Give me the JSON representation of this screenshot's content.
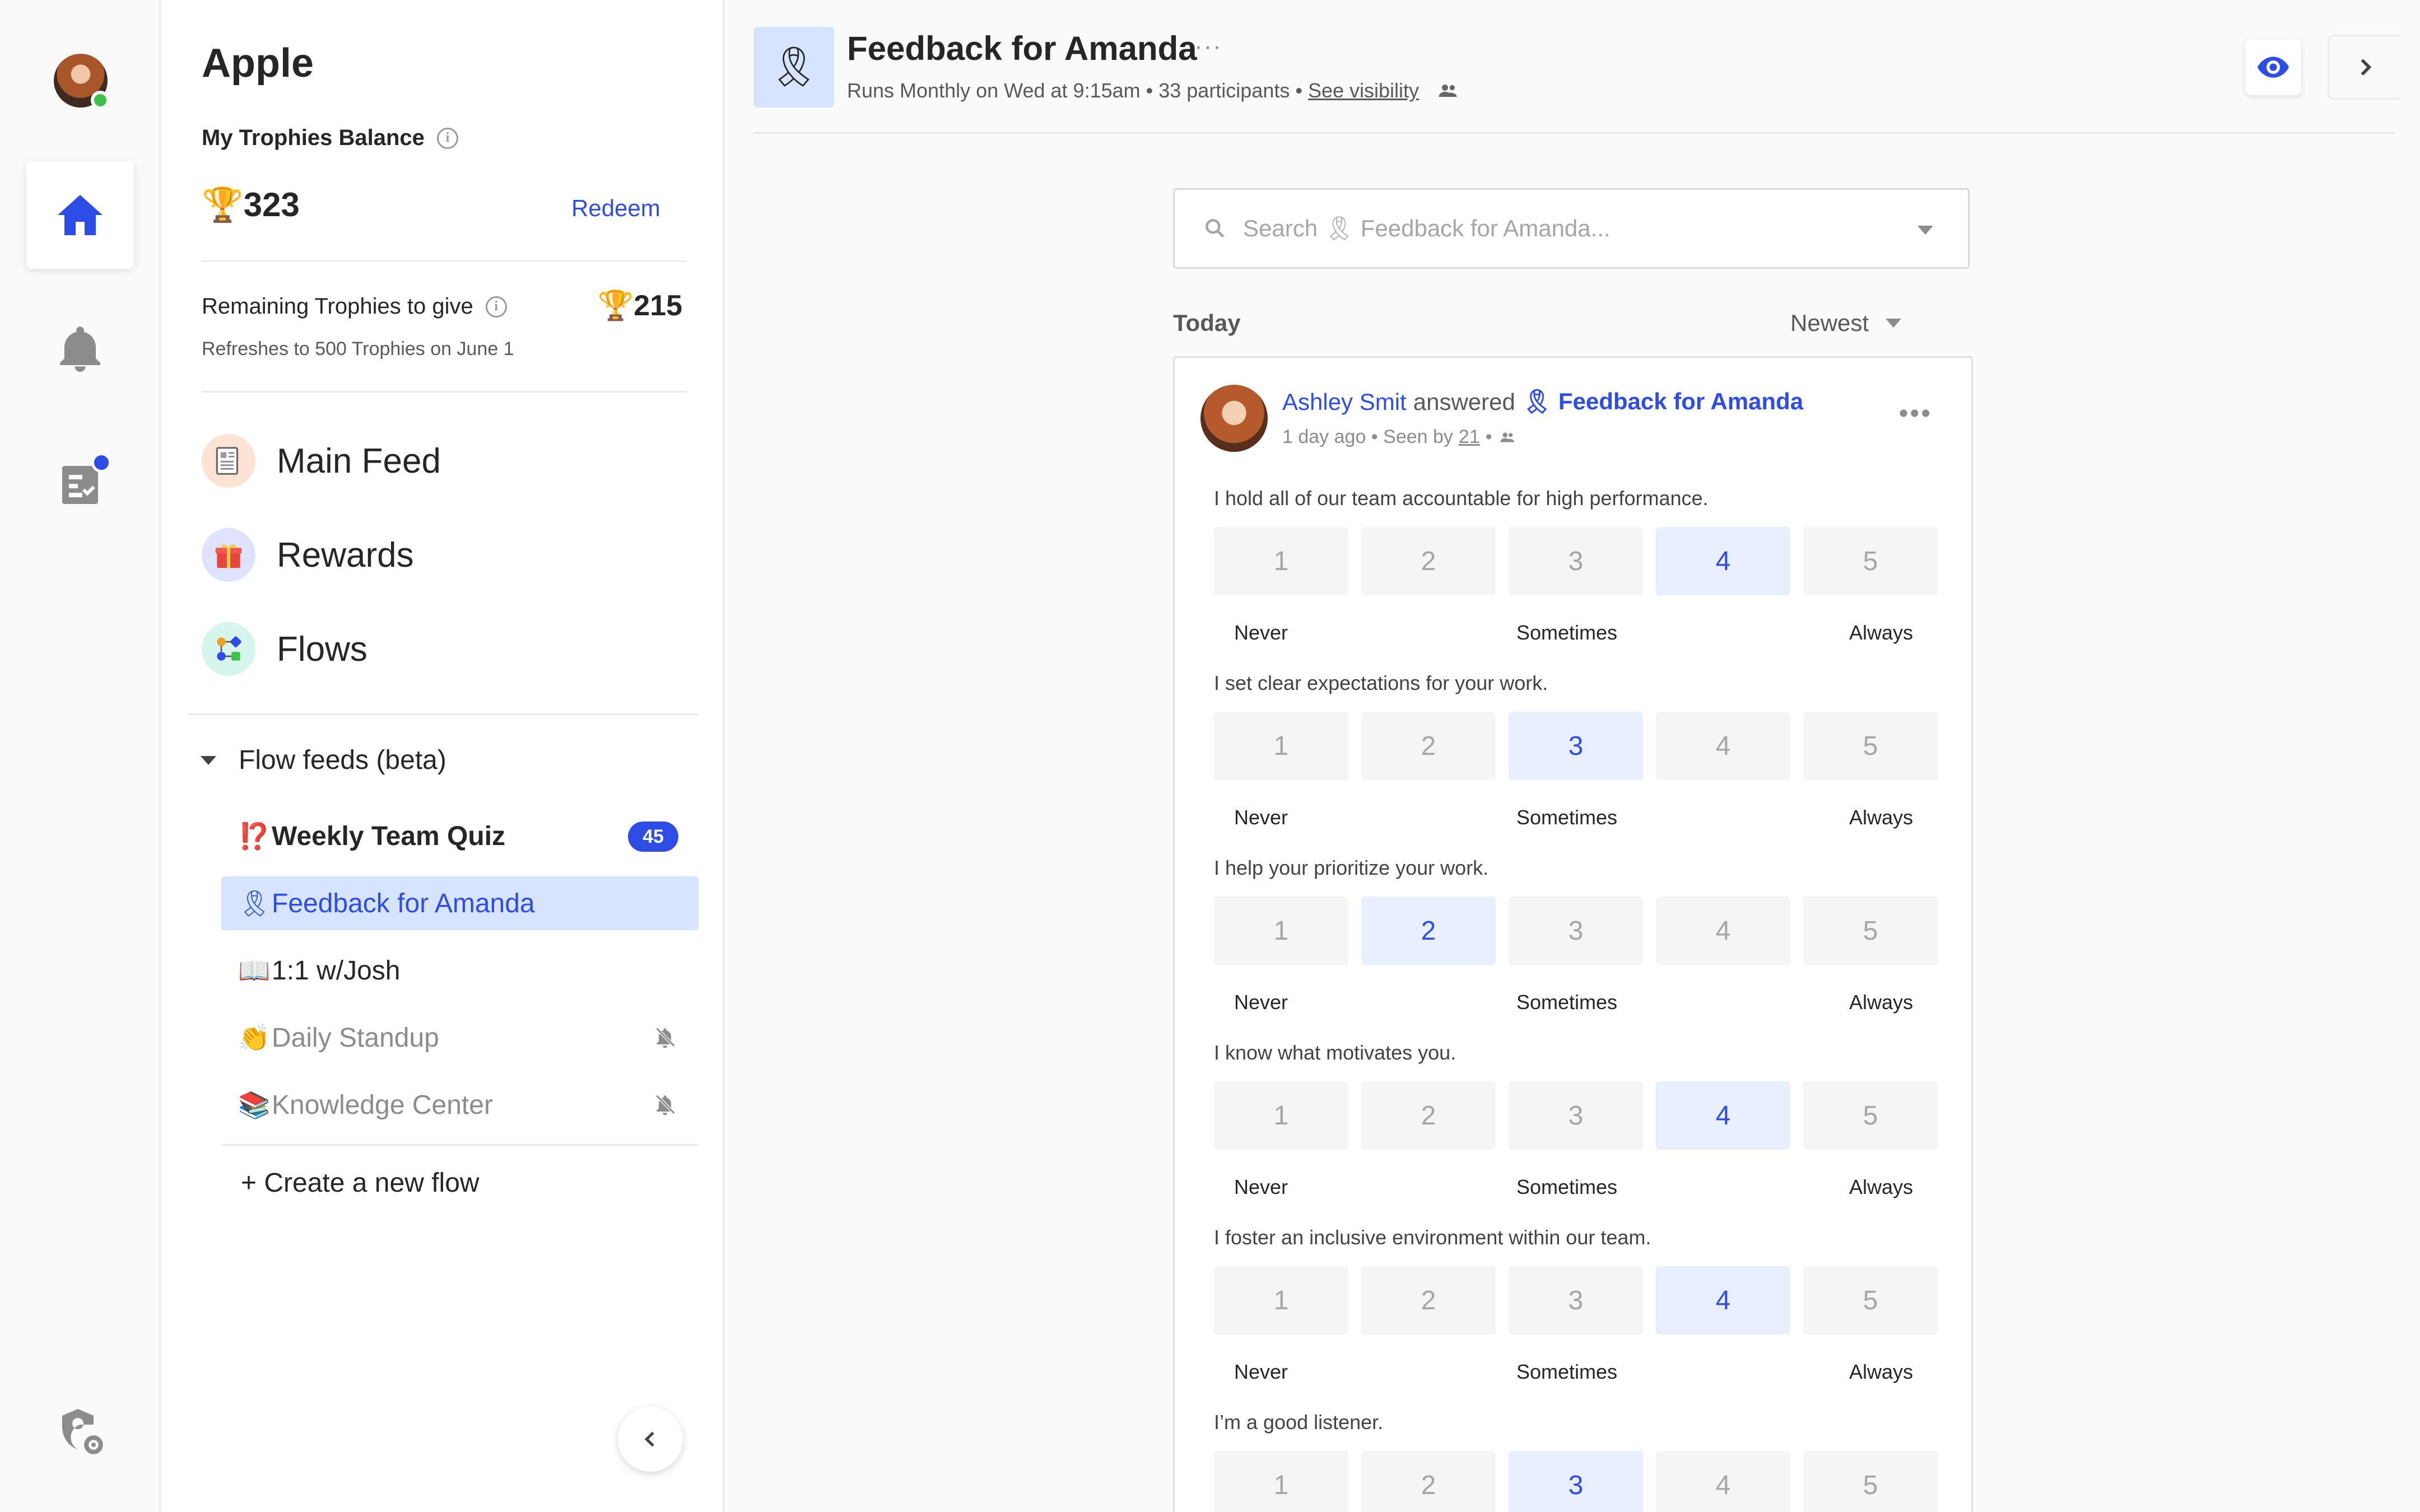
{
  "rail": {
    "icons": [
      "home-icon",
      "bell-icon",
      "tasks-icon",
      "admin-settings-icon"
    ]
  },
  "panel": {
    "org_name": "Apple",
    "balance_label": "My Trophies Balance",
    "balance_value": "🏆323",
    "redeem_label": "Redeem",
    "remaining_label": "Remaining Trophies to give",
    "remaining_value": "🏆215",
    "refresh_note": "Refreshes to 500 Trophies on June 1",
    "nav": [
      {
        "label": "Main Feed",
        "icon": "feed-icon"
      },
      {
        "label": "Rewards",
        "icon": "gift-icon"
      },
      {
        "label": "Flows",
        "icon": "flows-icon"
      }
    ],
    "flow_feeds_label": "Flow feeds (beta)",
    "flows": [
      {
        "emoji": "⁉️",
        "label": "Weekly Team Quiz",
        "count": "45"
      },
      {
        "emoji": "🎗",
        "label": "Feedback for Amanda"
      },
      {
        "emoji": "📖",
        "label": "1:1 w/Josh"
      },
      {
        "emoji": "👏",
        "label": "Daily Standup"
      },
      {
        "emoji": "📚",
        "label": "Knowledge Center"
      }
    ],
    "create_flow_label": "+ Create a new flow"
  },
  "header": {
    "emoji": "🎗",
    "title": "Feedback for Amanda",
    "more": "···",
    "subtitle": "Runs Monthly on Wed at 9:15am • 33 participants •",
    "visibility_link": "See visibility"
  },
  "feed": {
    "search_placeholder": "Search 🎗 Feedback for Amanda...",
    "day_label": "Today",
    "sort_label": "Newest",
    "post": {
      "author": "Ashley Smit",
      "verb": "answered",
      "flow": "🎗 Feedback for Amanda",
      "time": "1 day ago • Seen by",
      "seen_count": "21",
      "more": "•••",
      "scale_labels": {
        "low": "Never",
        "mid": "Sometimes",
        "high": "Always"
      },
      "questions": [
        {
          "text": "I hold all of our team accountable for high performance.",
          "selected": 4
        },
        {
          "text": "I set clear expectations for your work.",
          "selected": 3
        },
        {
          "text": "I help your prioritize your work.",
          "selected": 2
        },
        {
          "text": "I know what motivates you.",
          "selected": 4
        },
        {
          "text": "I foster an inclusive environment within our team.",
          "selected": 4
        },
        {
          "text": "I’m a good listener.",
          "selected": 3
        }
      ],
      "options": [
        "1",
        "2",
        "3",
        "4",
        "5"
      ]
    }
  },
  "colors": {
    "accent": "#2e4de6",
    "selected_bg": "#e8efff",
    "active_row_bg": "#d6e4ff"
  }
}
